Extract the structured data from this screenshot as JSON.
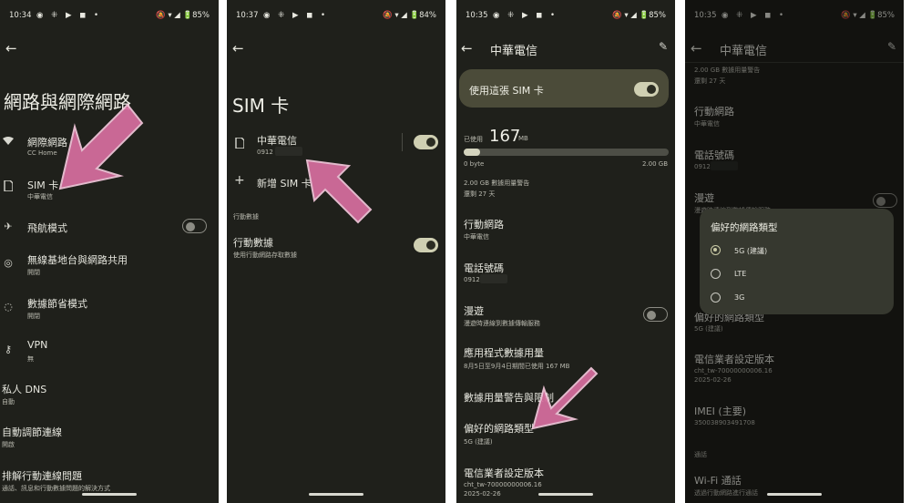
{
  "screen1": {
    "status": {
      "time": "10:34",
      "notif": "◉ ⁜ ▶ ◼ •",
      "right": "🔕 ▾ ◢ 🔋85%"
    },
    "title": "網路與網際網路",
    "items": [
      {
        "label": "網際網路",
        "sub": "CC Home"
      },
      {
        "label": "SIM 卡",
        "sub": "中華電信"
      },
      {
        "label": "飛航模式"
      },
      {
        "label": "無線基地台與網路共用",
        "sub": "開閉"
      },
      {
        "label": "數據節省模式",
        "sub": "開閉"
      },
      {
        "label": "VPN",
        "sub": "無"
      },
      {
        "label": "私人 DNS",
        "sub": "自動"
      },
      {
        "label": "自動調節連線",
        "sub": "開啟"
      },
      {
        "label": "排解行動連線問題",
        "sub": "通話、訊息和行動數據問題的解決方式"
      }
    ],
    "icons": {
      "wifi": "wifi-icon",
      "sim": "sim-card-icon",
      "airplane": "airplane-icon",
      "hotspot": "hotspot-icon",
      "saver": "data-saver-icon",
      "vpn": "vpn-key-icon"
    },
    "toggles": {
      "airplane": false
    }
  },
  "screen2": {
    "status": {
      "time": "10:37",
      "notif": "◉ ⁜ ▶ ◼ •",
      "right": "🔕 ▾ ◢ 🔋84%"
    },
    "title": "SIM 卡",
    "sim": {
      "name": "中華電信",
      "number": "0912"
    },
    "add": "新增 SIM 卡",
    "section": "行動數據",
    "mobile_data": {
      "label": "行動數據",
      "sub": "使用行動網路存取數據"
    },
    "toggles": {
      "sim": true,
      "mobile_data": true
    }
  },
  "screen3": {
    "status": {
      "time": "10:35",
      "notif": "◉ ⁜ ▶ ◼ •",
      "right": "🔕 ▾ ◢ 🔋85%"
    },
    "header": "中華電信",
    "use_sim": "使用這張 SIM 卡",
    "used_prefix": "已使用",
    "used_value": "167",
    "used_unit": "MB",
    "usage_fraction": 0.08,
    "range_min": "0 byte",
    "range_max": "2.00 GB",
    "warning": "2.00 GB 數據用量警告",
    "days_left": "還剩 27 天",
    "items": [
      {
        "label": "行動網路",
        "sub": "中華電信"
      },
      {
        "label": "電話號碼",
        "sub": "0912"
      },
      {
        "label": "漫遊",
        "sub": "漫遊時連線到數據傳輸服務"
      },
      {
        "label": "應用程式數據用量",
        "sub": "8月5日至9月4日期間已使用 167 MB"
      },
      {
        "label": "數據用量警告與限制"
      },
      {
        "label": "偏好的網路類型",
        "sub": "5G (建議)"
      },
      {
        "label": "電信業者設定版本",
        "sub": "cht_tw-70000000006.16",
        "sub2": "2025-02-26"
      }
    ],
    "toggles": {
      "use_sim": true,
      "roaming": false
    }
  },
  "screen4": {
    "status": {
      "time": "10:35",
      "notif": "◉ ⁜ ▶ ◼ •",
      "right": "🔕 ▾ ◢ 🔋85%"
    },
    "header": "中華電信",
    "top_sub1": "2.00 GB 數據用量警告",
    "top_sub2": "還剩 27 天",
    "items": [
      {
        "label": "行動網路",
        "sub": "中華電信"
      },
      {
        "label": "電話號碼",
        "sub": "0912"
      },
      {
        "label": "漫遊",
        "sub": "漫遊時連線到數據傳輸服務"
      },
      {
        "label": "偏好的網路類型",
        "sub": "5G (建議)"
      },
      {
        "label": "電信業者設定版本",
        "sub": "cht_tw-70000000006.16",
        "sub2": "2025-02-26"
      },
      {
        "label": "IMEI (主要)",
        "sub": "350038903491708"
      },
      {
        "label": "Wi-Fi 通話",
        "sub": "透過行動網路進行通話"
      }
    ],
    "section": "通話",
    "dialog": {
      "title": "偏好的網路類型",
      "options": [
        "5G (建議)",
        "LTE",
        "3G"
      ],
      "selected": 0
    }
  }
}
